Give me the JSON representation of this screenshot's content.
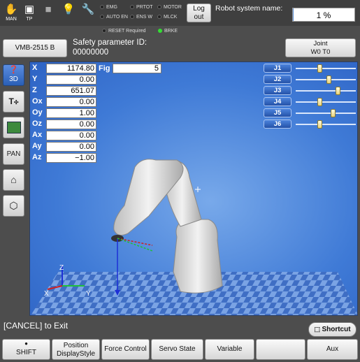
{
  "topbar": {
    "icons": [
      {
        "name": "hand-icon",
        "label": "MAN"
      },
      {
        "name": "teach-pendant-icon",
        "label": "TP"
      },
      {
        "name": "stop-icon",
        "label": ""
      },
      {
        "name": "lightbulb-icon",
        "label": ""
      },
      {
        "name": "wrench-icon",
        "label": ""
      }
    ],
    "lamps": [
      "EMG",
      "PRTOT",
      "MOTOR",
      "AUTO EN",
      "ENS W",
      "MLCK"
    ],
    "logout_label_1": "Log",
    "logout_label_2": "out",
    "robot_name_label": "Robot system name:",
    "progress_text": "1 %",
    "progress_value": 1
  },
  "row2": {
    "lamp_reset": "RESET Required",
    "lamp_brke": "BRKE",
    "model_button": "VMB-2515 B",
    "safety_label": "Safety parameter ID:",
    "safety_id": "00000000",
    "joint_label_1": "Joint",
    "joint_label_2": "W0 T0"
  },
  "sidebar": {
    "btn_3d": "3D",
    "btn_pan": "PAN"
  },
  "coords": [
    {
      "label": "X",
      "value": "1174.80"
    },
    {
      "label": "Y",
      "value": "0.00"
    },
    {
      "label": "Z",
      "value": "651.07"
    },
    {
      "label": "Ox",
      "value": "0.00"
    },
    {
      "label": "Oy",
      "value": "1.00"
    },
    {
      "label": "Oz",
      "value": "0.00"
    },
    {
      "label": "Ax",
      "value": "0.00"
    },
    {
      "label": "Ay",
      "value": "0.00"
    },
    {
      "label": "Az",
      "value": "−1.00"
    }
  ],
  "fig": {
    "label": "Fig",
    "value": "5"
  },
  "joints": [
    {
      "label": "J1",
      "pos": 0.4
    },
    {
      "label": "J2",
      "pos": 0.55
    },
    {
      "label": "J3",
      "pos": 0.7
    },
    {
      "label": "J4",
      "pos": 0.4
    },
    {
      "label": "J5",
      "pos": 0.62
    },
    {
      "label": "J6",
      "pos": 0.4
    }
  ],
  "axes": {
    "x": "X",
    "y": "Y",
    "z": "Z"
  },
  "bottom": {
    "cancel_text": "[CANCEL] to Exit",
    "shortcut": "Shortcut",
    "fbuttons": [
      "SHIFT",
      "Position DisplayStyle",
      "Force Control",
      "Servo State",
      "Variable",
      "",
      "Aux"
    ]
  },
  "colors": {
    "viewport": "#4a83dc",
    "jog_button": "#2f62bd",
    "brke_lamp": "#33dd33"
  }
}
